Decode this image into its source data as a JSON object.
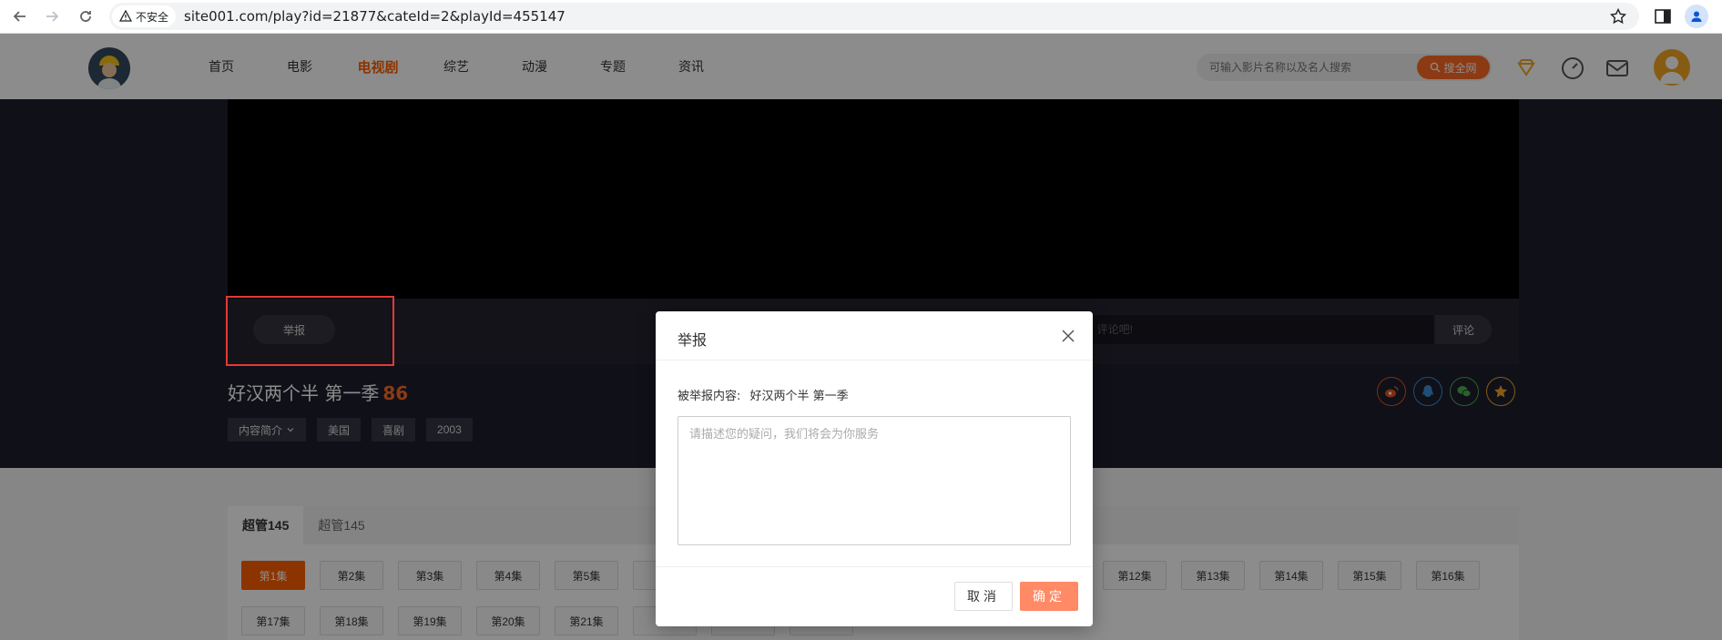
{
  "browser": {
    "security_label": "不安全",
    "url": "site001.com/play?id=21877&cateId=2&playId=455147"
  },
  "nav": {
    "items": [
      {
        "label": "首页"
      },
      {
        "label": "电影"
      },
      {
        "label": "电视剧"
      },
      {
        "label": "综艺"
      },
      {
        "label": "动漫"
      },
      {
        "label": "专题"
      },
      {
        "label": "资讯"
      }
    ],
    "active_index": 2
  },
  "search": {
    "placeholder": "可输入影片名称以及名人搜索",
    "button_label": "搜全网"
  },
  "player": {
    "report_label": "举报",
    "comment_placeholder": "评论吧!",
    "comment_button": "评论"
  },
  "show": {
    "title": "好汉两个半 第一季",
    "score": "86",
    "tags": [
      "内容简介",
      "美国",
      "喜剧",
      "2003"
    ]
  },
  "episodes": {
    "tabs": [
      "超管145",
      "超管145"
    ],
    "row1": [
      "第1集",
      "第2集",
      "第3集",
      "第4集",
      "第5集",
      "第",
      "第12集",
      "第13集",
      "第14集",
      "第15集",
      "第16集"
    ],
    "row2": [
      "第17集",
      "第18集",
      "第19集",
      "第20集",
      "第21集",
      "第"
    ]
  },
  "modal": {
    "title": "举报",
    "content_label": "被举报内容:",
    "content_value": "好汉两个半 第一季",
    "textarea_placeholder": "请描述您的疑问，我们将会为你服务",
    "cancel_label": "取消",
    "ok_label": "确定"
  },
  "colors": {
    "accent": "#ff5f00",
    "highlight": "#e53935",
    "overlay": "rgba(0,0,0,0.45)"
  }
}
